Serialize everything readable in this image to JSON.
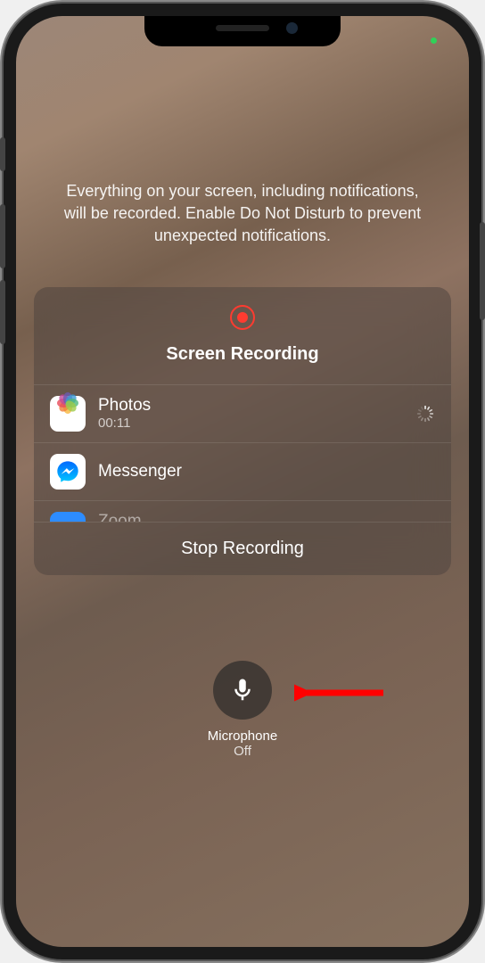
{
  "info_text": "Everything on your screen, including notifications, will be recorded. Enable Do Not Disturb to prevent unexpected notifications.",
  "card": {
    "title": "Screen Recording",
    "rows": [
      {
        "label": "Photos",
        "subtitle": "00:11",
        "loading": true
      },
      {
        "label": "Messenger"
      },
      {
        "label": "Zoom",
        "partial": true
      }
    ],
    "stop_label": "Stop Recording"
  },
  "mic": {
    "label": "Microphone",
    "state": "Off"
  }
}
